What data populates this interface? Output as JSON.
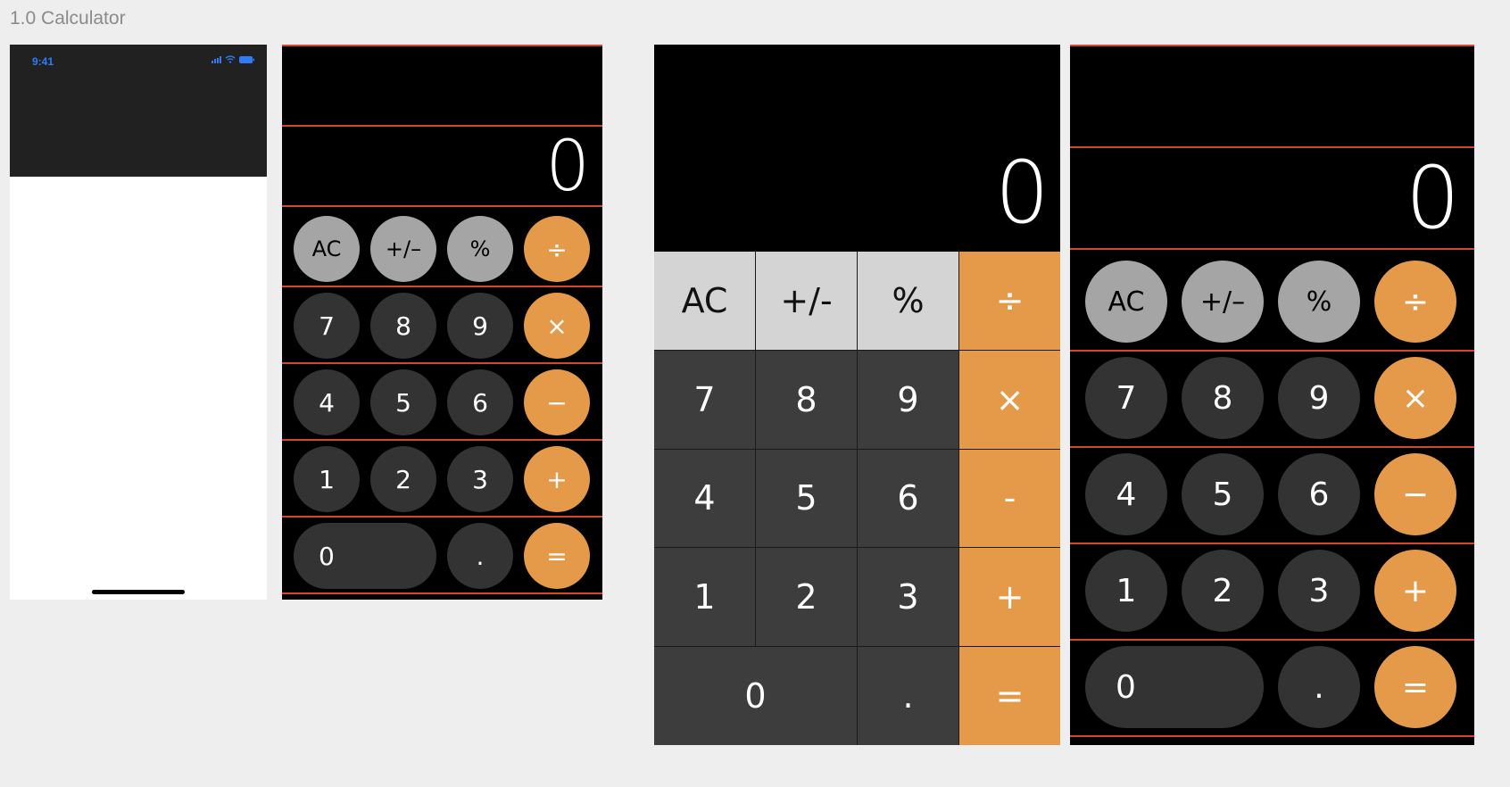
{
  "page": {
    "title": "1.0 Calculator"
  },
  "phone_frame": {
    "time": "9:41",
    "icons": [
      "signal-bars-icon",
      "wifi-icon",
      "battery-icon"
    ],
    "accent_color": "#2f7cf6",
    "statusbar_color": "#212121"
  },
  "calculator": {
    "display_value": "0",
    "rows": [
      [
        {
          "label": "AC",
          "kind": "func",
          "name": "ac-button"
        },
        {
          "label": "+/–",
          "kind": "func",
          "name": "sign-toggle-button"
        },
        {
          "label": "%",
          "kind": "func",
          "name": "percent-button"
        },
        {
          "label": "÷",
          "kind": "op",
          "name": "divide-button"
        }
      ],
      [
        {
          "label": "7",
          "kind": "num",
          "name": "digit-7-button"
        },
        {
          "label": "8",
          "kind": "num",
          "name": "digit-8-button"
        },
        {
          "label": "9",
          "kind": "num",
          "name": "digit-9-button"
        },
        {
          "label": "×",
          "kind": "op",
          "name": "multiply-button"
        }
      ],
      [
        {
          "label": "4",
          "kind": "num",
          "name": "digit-4-button"
        },
        {
          "label": "5",
          "kind": "num",
          "name": "digit-5-button"
        },
        {
          "label": "6",
          "kind": "num",
          "name": "digit-6-button"
        },
        {
          "label": "−",
          "kind": "op",
          "name": "subtract-button"
        }
      ],
      [
        {
          "label": "1",
          "kind": "num",
          "name": "digit-1-button"
        },
        {
          "label": "2",
          "kind": "num",
          "name": "digit-2-button"
        },
        {
          "label": "3",
          "kind": "num",
          "name": "digit-3-button"
        },
        {
          "label": "+",
          "kind": "op",
          "name": "add-button"
        }
      ],
      [
        {
          "label": "0",
          "kind": "num",
          "name": "digit-0-button",
          "wide": true
        },
        {
          "label": ".",
          "kind": "num",
          "name": "decimal-button"
        },
        {
          "label": "=",
          "kind": "op",
          "name": "equals-button"
        }
      ]
    ],
    "flat_rows": [
      [
        {
          "label": "AC",
          "kind": "func",
          "name": "ac-button"
        },
        {
          "label": "+/-",
          "kind": "func",
          "name": "sign-toggle-button"
        },
        {
          "label": "%",
          "kind": "func",
          "name": "percent-button"
        },
        {
          "label": "÷",
          "kind": "op",
          "name": "divide-button"
        }
      ],
      [
        {
          "label": "7",
          "kind": "num",
          "name": "digit-7-button"
        },
        {
          "label": "8",
          "kind": "num",
          "name": "digit-8-button"
        },
        {
          "label": "9",
          "kind": "num",
          "name": "digit-9-button"
        },
        {
          "label": "×",
          "kind": "op",
          "name": "multiply-button"
        }
      ],
      [
        {
          "label": "4",
          "kind": "num",
          "name": "digit-4-button"
        },
        {
          "label": "5",
          "kind": "num",
          "name": "digit-5-button"
        },
        {
          "label": "6",
          "kind": "num",
          "name": "digit-6-button"
        },
        {
          "label": "-",
          "kind": "op",
          "name": "subtract-button"
        }
      ],
      [
        {
          "label": "1",
          "kind": "num",
          "name": "digit-1-button"
        },
        {
          "label": "2",
          "kind": "num",
          "name": "digit-2-button"
        },
        {
          "label": "3",
          "kind": "num",
          "name": "digit-3-button"
        },
        {
          "label": "+",
          "kind": "op",
          "name": "add-button"
        }
      ],
      [
        {
          "label": "0",
          "kind": "num",
          "name": "digit-0-button",
          "wide": true
        },
        {
          "label": ".",
          "kind": "num",
          "name": "decimal-button"
        },
        {
          "label": "=",
          "kind": "op",
          "name": "equals-button"
        }
      ]
    ],
    "colors": {
      "background": "#000000",
      "number_key": "#333333",
      "function_key": "#a5a5a5",
      "operator_key": "#e59a49",
      "guide_line": "#d4472c",
      "flat_number_key": "#3d3d3d",
      "flat_function_key": "#d4d4d4"
    }
  }
}
